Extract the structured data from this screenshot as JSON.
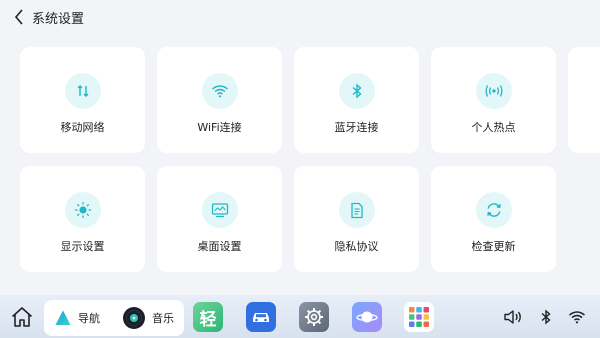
{
  "header": {
    "title": "系统设置"
  },
  "cards": [
    {
      "label": "移动网络",
      "icon": "mobile-data-icon"
    },
    {
      "label": "WiFi连接",
      "icon": "wifi-icon"
    },
    {
      "label": "蓝牙连接",
      "icon": "bluetooth-icon"
    },
    {
      "label": "个人热点",
      "icon": "hotspot-icon"
    },
    {
      "label": "显示设置",
      "icon": "brightness-icon"
    },
    {
      "label": "桌面设置",
      "icon": "desktop-icon"
    },
    {
      "label": "隐私协议",
      "icon": "document-icon"
    },
    {
      "label": "检查更新",
      "icon": "refresh-icon"
    }
  ],
  "dock": {
    "nav_label": "导航",
    "music_label": "音乐",
    "qing_label": "轻",
    "status": [
      "volume-icon",
      "bluetooth-icon",
      "wifi-icon"
    ]
  },
  "colors": {
    "accent": "#20b8c4",
    "icon_bg": "#e3f7f8",
    "page_bg": "#f2f4f7"
  }
}
